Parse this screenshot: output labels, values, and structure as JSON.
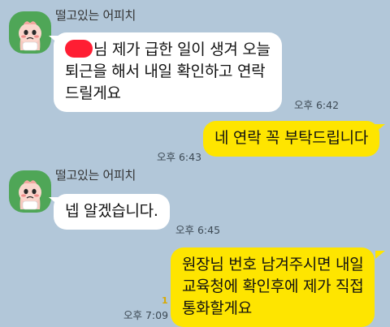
{
  "colors": {
    "background": "#b2c7d9",
    "incoming_bubble": "#ffffff",
    "outgoing_bubble": "#fee500",
    "avatar_bg": "#4fa657",
    "redaction": "#ff1e33",
    "unread_counter": "#d8a900"
  },
  "messages": [
    {
      "direction": "incoming",
      "sender": "떨고있는 어피치",
      "avatar_icon": "apeach-avatar-icon",
      "lines": [
        "님 제가 급한 일이 생겨 오늘",
        "퇴근을 해서 내일 확인하고 연락",
        "드릴게요"
      ],
      "redacted_prefix": true,
      "time": "오후 6:42"
    },
    {
      "direction": "outgoing",
      "lines": [
        "네 연락 꼭 부탁드립니다"
      ],
      "time": "오후 6:43"
    },
    {
      "direction": "incoming",
      "sender": "떨고있는 어피치",
      "avatar_icon": "apeach-avatar-icon",
      "lines": [
        "넵 알겠습니다."
      ],
      "time": "오후 6:45"
    },
    {
      "direction": "outgoing",
      "lines": [
        "원장님 번호 남겨주시면 내일",
        "교육청에 확인후에 제가 직접",
        "통화할게요"
      ],
      "unread_count": "1",
      "time": "오후 7:09"
    }
  ]
}
